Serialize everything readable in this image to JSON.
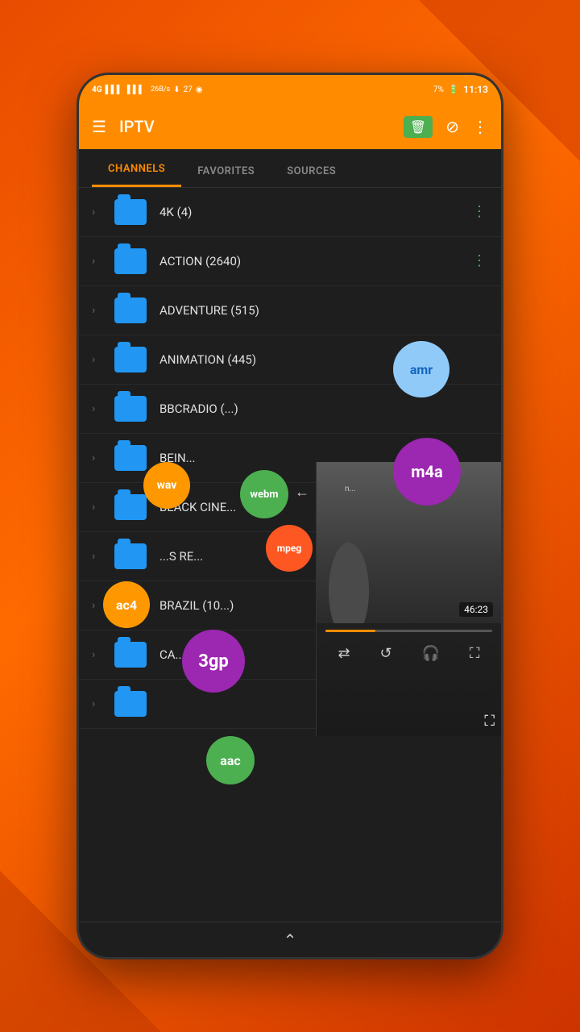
{
  "statusBar": {
    "networkType": "4G",
    "signalBars1": "▌▌▌",
    "dataSpeed": "26B/s",
    "download": "27",
    "time": "11:13",
    "battery": "7%"
  },
  "appBar": {
    "title": "IPTV",
    "menuIcon": "☰",
    "deleteIcon": "🗑",
    "hideIcon": "⊘",
    "moreIcon": "⋮"
  },
  "tabs": [
    {
      "id": "channels",
      "label": "CHANNELS",
      "active": true
    },
    {
      "id": "favorites",
      "label": "FAVORITES",
      "active": false
    },
    {
      "id": "sources",
      "label": "SOURCES",
      "active": false
    }
  ],
  "channels": [
    {
      "name": "4K (4)",
      "showMore": true
    },
    {
      "name": "ACTION (2640)",
      "showMore": true
    },
    {
      "name": "ADVENTURE (515)",
      "showMore": false
    },
    {
      "name": "ANIMATION (445)",
      "showMore": false
    },
    {
      "name": "BBCRADIO (...)",
      "showMore": false
    },
    {
      "name": "BEIN...",
      "showMore": false
    },
    {
      "name": "BLACK CINE...",
      "showMore": false
    },
    {
      "name": "...S RE...",
      "showMore": false
    },
    {
      "name": "BRAZIL (10...)",
      "showMore": false
    },
    {
      "name": "CA...  (1...",
      "showMore": false
    }
  ],
  "badges": [
    {
      "id": "wav",
      "label": "wav",
      "color": "#ff9800"
    },
    {
      "id": "webm",
      "label": "webm",
      "color": "#4caf50"
    },
    {
      "id": "m4a",
      "label": "m4a",
      "color": "#9c27b0"
    },
    {
      "id": "amr",
      "label": "amr",
      "color": "#90caf9"
    },
    {
      "id": "mpeg",
      "label": "mpeg",
      "color": "#ff5722"
    },
    {
      "id": "ac4",
      "label": "ac4",
      "color": "#ff9800"
    },
    {
      "id": "3gp",
      "label": "3gp",
      "color": "#9c27b0"
    },
    {
      "id": "aac",
      "label": "aac",
      "color": "#4caf50"
    }
  ],
  "videoOverlay": {
    "timeStamp": "46:23",
    "progressPercent": 30
  },
  "bottomBar": {
    "icon": "⌃"
  }
}
